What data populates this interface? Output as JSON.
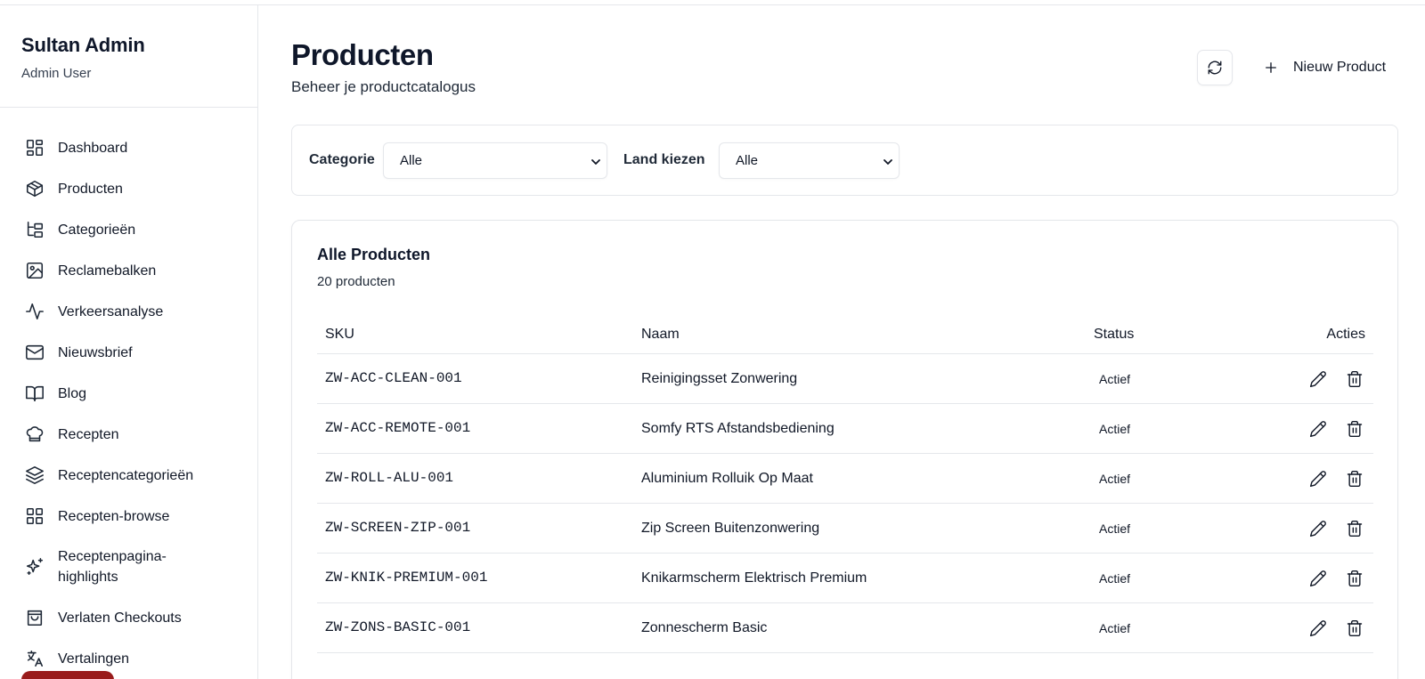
{
  "sidebar": {
    "brand_title": "Sultan Admin",
    "brand_user": "Admin User",
    "items": [
      {
        "label": "Dashboard",
        "icon": "layout-dashboard-icon"
      },
      {
        "label": "Producten",
        "icon": "package-icon"
      },
      {
        "label": "Categorieën",
        "icon": "folder-tree-icon"
      },
      {
        "label": "Reclamebalken",
        "icon": "image-icon"
      },
      {
        "label": "Verkeersanalyse",
        "icon": "activity-icon"
      },
      {
        "label": "Nieuwsbrief",
        "icon": "mail-icon"
      },
      {
        "label": "Blog",
        "icon": "book-open-icon"
      },
      {
        "label": "Recepten",
        "icon": "chef-hat-icon"
      },
      {
        "label": "Receptencategorieën",
        "icon": "layers-icon"
      },
      {
        "label": "Recepten-browse",
        "icon": "grid-icon"
      },
      {
        "label": "Receptenpagina-highlights",
        "icon": "sparkles-icon"
      },
      {
        "label": "Verlaten Checkouts",
        "icon": "shopping-bag-icon"
      },
      {
        "label": "Vertalingen",
        "icon": "languages-icon"
      }
    ]
  },
  "header": {
    "title": "Producten",
    "subtitle": "Beheer je productcatalogus",
    "new_label": "Nieuw Product"
  },
  "filters": {
    "category_label": "Categorie",
    "category_value": "Alle",
    "country_label": "Land kiezen",
    "country_value": "Alle"
  },
  "table": {
    "title": "Alle Producten",
    "count": "20 producten",
    "columns": {
      "sku": "SKU",
      "name": "Naam",
      "status": "Status",
      "actions": "Acties"
    },
    "rows": [
      {
        "sku": "ZW-ACC-CLEAN-001",
        "name": "Reinigingsset Zonwering",
        "status": "Actief"
      },
      {
        "sku": "ZW-ACC-REMOTE-001",
        "name": "Somfy RTS Afstandsbediening",
        "status": "Actief"
      },
      {
        "sku": "ZW-ROLL-ALU-001",
        "name": "Aluminium Rolluik Op Maat",
        "status": "Actief"
      },
      {
        "sku": "ZW-SCREEN-ZIP-001",
        "name": "Zip Screen Buitenzonwering",
        "status": "Actief"
      },
      {
        "sku": "ZW-KNIK-PREMIUM-001",
        "name": "Knikarmscherm Elektrisch Premium",
        "status": "Actief"
      },
      {
        "sku": "ZW-ZONS-BASIC-001",
        "name": "Zonnescherm Basic",
        "status": "Actief"
      }
    ]
  },
  "colors": {
    "text": "#0f172a",
    "border": "#e5e7eb",
    "danger": "#991b1b"
  }
}
